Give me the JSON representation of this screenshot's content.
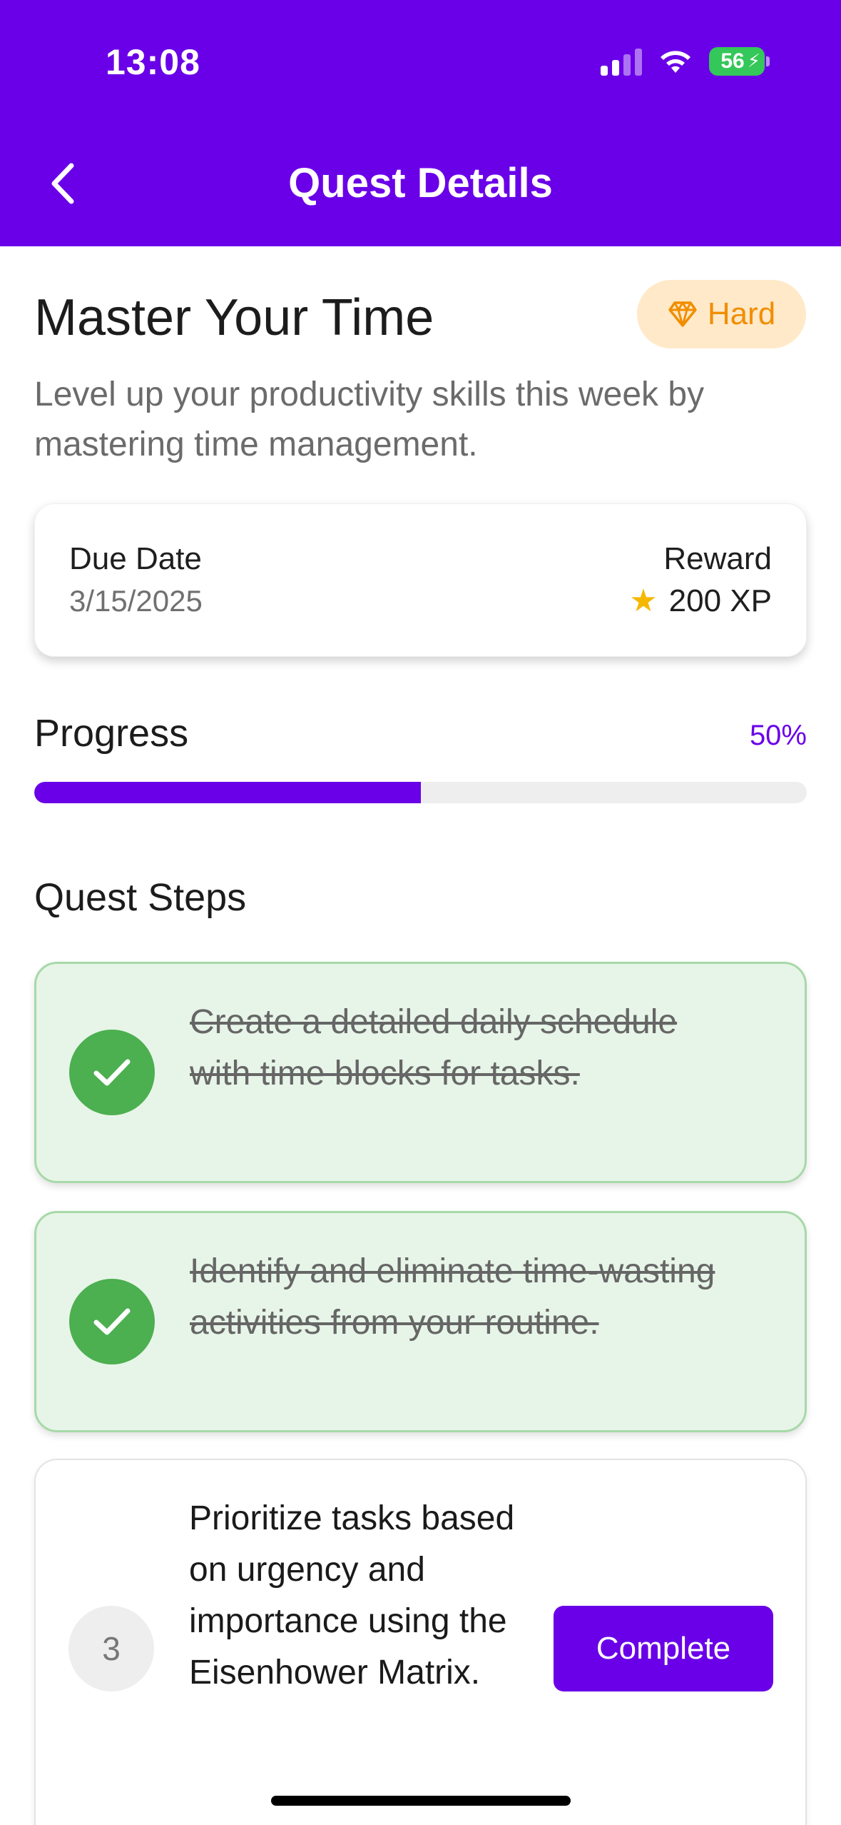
{
  "status_bar": {
    "time": "13:08",
    "battery": "56"
  },
  "header": {
    "title": "Quest Details",
    "back_icon": "chevron-left-icon"
  },
  "quest": {
    "title": "Master Your Time",
    "difficulty": "Hard",
    "difficulty_icon": "diamond-icon",
    "description": "Level up your productivity skills this week by mastering time management."
  },
  "info": {
    "due_label": "Due Date",
    "due_value": "3/15/2025",
    "reward_label": "Reward",
    "reward_value": "200 XP",
    "reward_icon": "star-icon"
  },
  "progress": {
    "label": "Progress",
    "percent_text": "50%",
    "value": 0.5
  },
  "steps": {
    "heading": "Quest Steps",
    "items": [
      {
        "text": "Create a detailed daily schedule with time blocks for tasks.",
        "completed": true
      },
      {
        "text": "Identify and eliminate time-wasting activities from your routine.",
        "completed": true
      },
      {
        "number": "3",
        "text": "Prioritize tasks based on urgency and importance using the Eisenhower Matrix.",
        "completed": false,
        "button_label": "Complete"
      }
    ]
  },
  "colors": {
    "primary": "#6a00e8",
    "success": "#4caf50",
    "badge_bg": "#ffe9c9",
    "badge_text": "#f18e00"
  }
}
